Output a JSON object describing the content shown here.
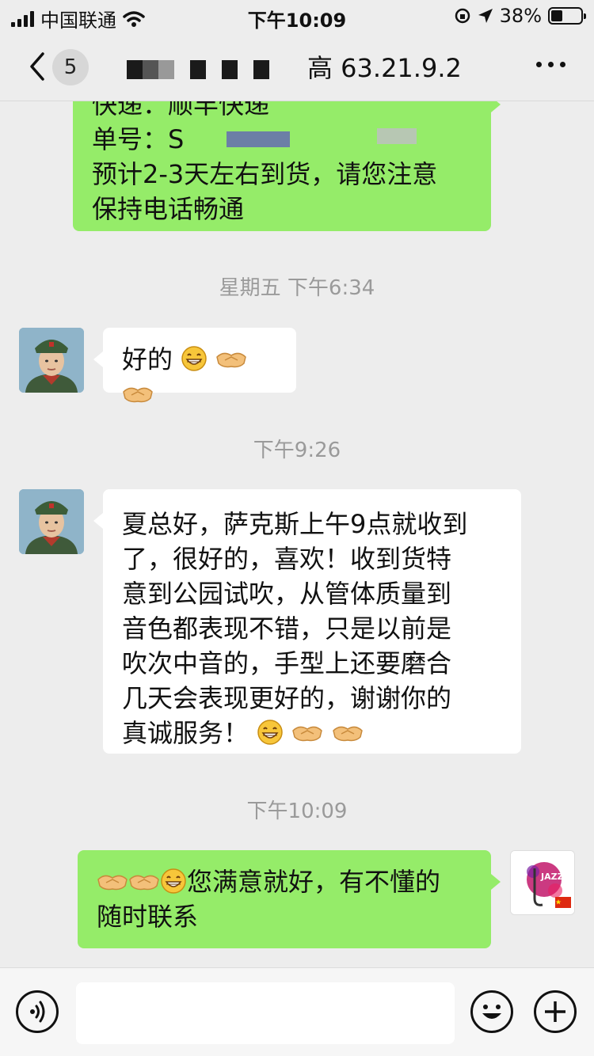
{
  "status_bar": {
    "carrier": "中国联通",
    "time": "下午10:09",
    "battery": "38%",
    "battery_level": 0.38
  },
  "nav": {
    "unread_count": "5",
    "title": "高 63.21.9.2"
  },
  "messages": {
    "m1": {
      "lines": [
        "快递：顺丰快递",
        "单号：S",
        "预计2-3天左右到货，请您注意",
        "保持电话畅通"
      ]
    },
    "ts1": "星期五 下午6:34",
    "m2": {
      "text": "好的"
    },
    "ts2": "下午9:26",
    "m3": {
      "lines": [
        "夏总好，萨克斯上午9点就收到",
        "了，很好的，喜欢！收到货特",
        "意到公园试吹，从管体质量到",
        "音色都表现不错，只是以前是",
        "吹次中音的，手型上还要磨合",
        "几天会表现更好的，谢谢你的",
        "真诚服务！"
      ]
    },
    "ts3": "下午10:09",
    "m4": {
      "line1": "您满意就好，有不懂的",
      "line2": "随时联系"
    }
  },
  "my_avatar": {
    "label": "JAZZ"
  },
  "colors": {
    "sent_bubble": "#95ec69",
    "received_bubble": "#ffffff",
    "background": "#ededed"
  },
  "icons": {
    "voice": "voice-icon",
    "emoji": "emoji-icon",
    "add": "add-icon",
    "back": "back-arrow-icon",
    "more": "more-icon"
  }
}
